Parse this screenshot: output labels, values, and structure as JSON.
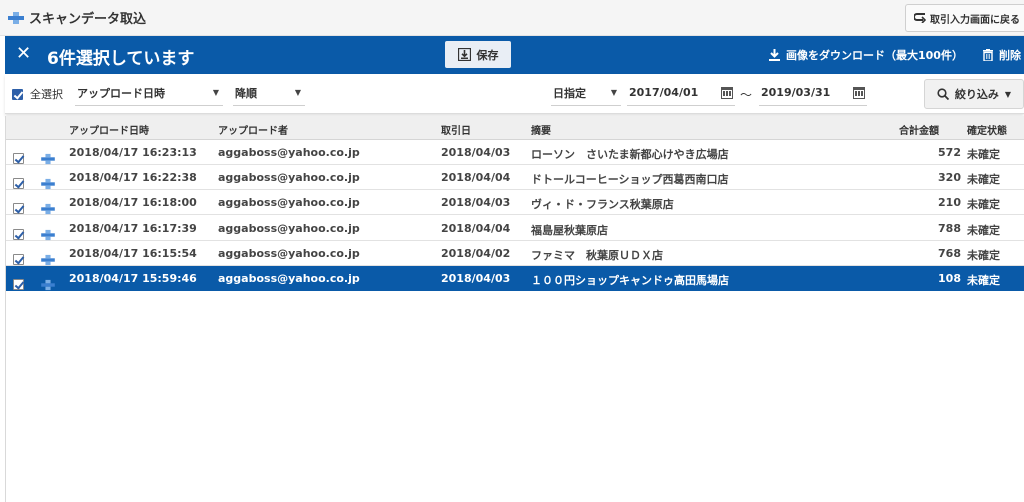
{
  "header": {
    "title": "スキャンデータ取込",
    "back_label": "取引入力画面に戻る"
  },
  "selection_bar": {
    "close_glyph": "✕",
    "count_label": "6件選択しています",
    "save_label": "保存",
    "download_label": "画像をダウンロード（最大100件）",
    "delete_label": "削除"
  },
  "filters": {
    "select_all_label": "全選択",
    "sort_field": "アップロード日時",
    "sort_order": "降順",
    "date_mode": "日指定",
    "date_from": "2017/04/01",
    "date_sep": "～",
    "date_to": "2019/03/31",
    "filter_label": "絞り込み"
  },
  "table": {
    "columns": [
      "アップロード日時",
      "アップロード者",
      "取引日",
      "摘要",
      "合計金額",
      "確定状態"
    ],
    "rows": [
      {
        "uploaded": "2018/04/17 16:23:13",
        "uploader": "aggaboss@yahoo.co.jp",
        "date": "2018/04/03",
        "memo": "ローソン　さいたま新都心けやき広場店",
        "amount": "572",
        "status": "未確定",
        "checked": true,
        "selected": false
      },
      {
        "uploaded": "2018/04/17 16:22:38",
        "uploader": "aggaboss@yahoo.co.jp",
        "date": "2018/04/04",
        "memo": "ドトールコーヒーショップ西葛西南口店",
        "amount": "320",
        "status": "未確定",
        "checked": true,
        "selected": false
      },
      {
        "uploaded": "2018/04/17 16:18:00",
        "uploader": "aggaboss@yahoo.co.jp",
        "date": "2018/04/03",
        "memo": "ヴィ・ド・フランス秋葉原店",
        "amount": "210",
        "status": "未確定",
        "checked": true,
        "selected": false
      },
      {
        "uploaded": "2018/04/17 16:17:39",
        "uploader": "aggaboss@yahoo.co.jp",
        "date": "2018/04/04",
        "memo": "福島屋秋葉原店",
        "amount": "788",
        "status": "未確定",
        "checked": true,
        "selected": false
      },
      {
        "uploaded": "2018/04/17 16:15:54",
        "uploader": "aggaboss@yahoo.co.jp",
        "date": "2018/04/02",
        "memo": "ファミマ　秋葉原ＵＤＸ店",
        "amount": "768",
        "status": "未確定",
        "checked": true,
        "selected": false
      },
      {
        "uploaded": "2018/04/17 15:59:46",
        "uploader": "aggaboss@yahoo.co.jp",
        "date": "2018/04/03",
        "memo": "１００円ショップキャンドゥ高田馬場店",
        "amount": "108",
        "status": "未確定",
        "checked": true,
        "selected": true
      }
    ]
  },
  "icons": {
    "scan": "scan-icon",
    "save": "save-icon",
    "download": "download-icon",
    "delete": "trash-icon",
    "calendar": "calendar-icon",
    "filter": "magnifier-icon"
  },
  "colors": {
    "accent": "#0a5aa8",
    "selected_row": "#0a5aa8",
    "checkbox": "#2d5fa8"
  }
}
